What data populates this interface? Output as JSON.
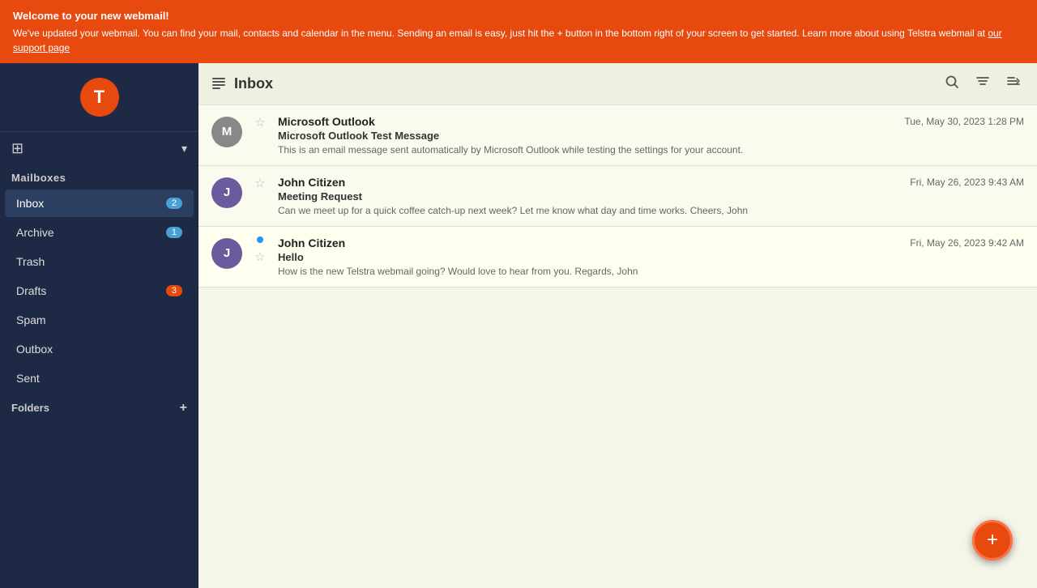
{
  "banner": {
    "title": "Welcome to your new webmail!",
    "body": "We've updated your webmail. You can find your mail, contacts and calendar in the menu. Sending an email is easy, just hit the + button in the bottom right of your screen to get started. Learn more about using Telstra webmail at ",
    "link_text": "our support page",
    "link_href": "#"
  },
  "sidebar": {
    "logo_letter": "T",
    "mailboxes_label": "Mailboxes",
    "items": [
      {
        "id": "inbox",
        "label": "Inbox",
        "badge": "2",
        "active": true
      },
      {
        "id": "archive",
        "label": "Archive",
        "badge": "1",
        "active": false
      },
      {
        "id": "trash",
        "label": "Trash",
        "badge": "",
        "active": false
      },
      {
        "id": "drafts",
        "label": "Drafts",
        "badge": "3",
        "active": false
      },
      {
        "id": "spam",
        "label": "Spam",
        "badge": "",
        "active": false
      },
      {
        "id": "outbox",
        "label": "Outbox",
        "badge": "",
        "active": false
      },
      {
        "id": "sent",
        "label": "Sent",
        "badge": "",
        "active": false
      }
    ],
    "folders_label": "Folders"
  },
  "content": {
    "header": {
      "title": "Inbox"
    },
    "emails": [
      {
        "id": 1,
        "sender": "Microsoft Outlook",
        "avatar_letter": "M",
        "avatar_color": "#888",
        "subject": "Microsoft Outlook Test Message",
        "preview": "This is an email message sent automatically by Microsoft Outlook while testing the settings for your account.",
        "date": "Tue, May 30, 2023 1:28 PM",
        "unread": false,
        "starred": false
      },
      {
        "id": 2,
        "sender": "John Citizen",
        "avatar_letter": "J",
        "avatar_color": "#6b5b9e",
        "subject": "Meeting Request",
        "preview": "Can we meet up for a quick coffee catch-up next week? Let me know what day and time works. Cheers, John",
        "date": "Fri, May 26, 2023 9:43 AM",
        "unread": false,
        "starred": false
      },
      {
        "id": 3,
        "sender": "John Citizen",
        "avatar_letter": "J",
        "avatar_color": "#6b5b9e",
        "subject": "Hello",
        "preview": "How is the new Telstra webmail going? Would love to hear from you. Regards, John",
        "date": "Fri, May 26, 2023 9:42 AM",
        "unread": true,
        "starred": false
      }
    ]
  },
  "fab": {
    "label": "+"
  },
  "icons": {
    "search": "🔍",
    "filter": "⚡",
    "sort": "≡",
    "star_empty": "☆",
    "star_filled": "★",
    "grid": "⊞",
    "plus": "+",
    "chevron_down": "▾"
  }
}
